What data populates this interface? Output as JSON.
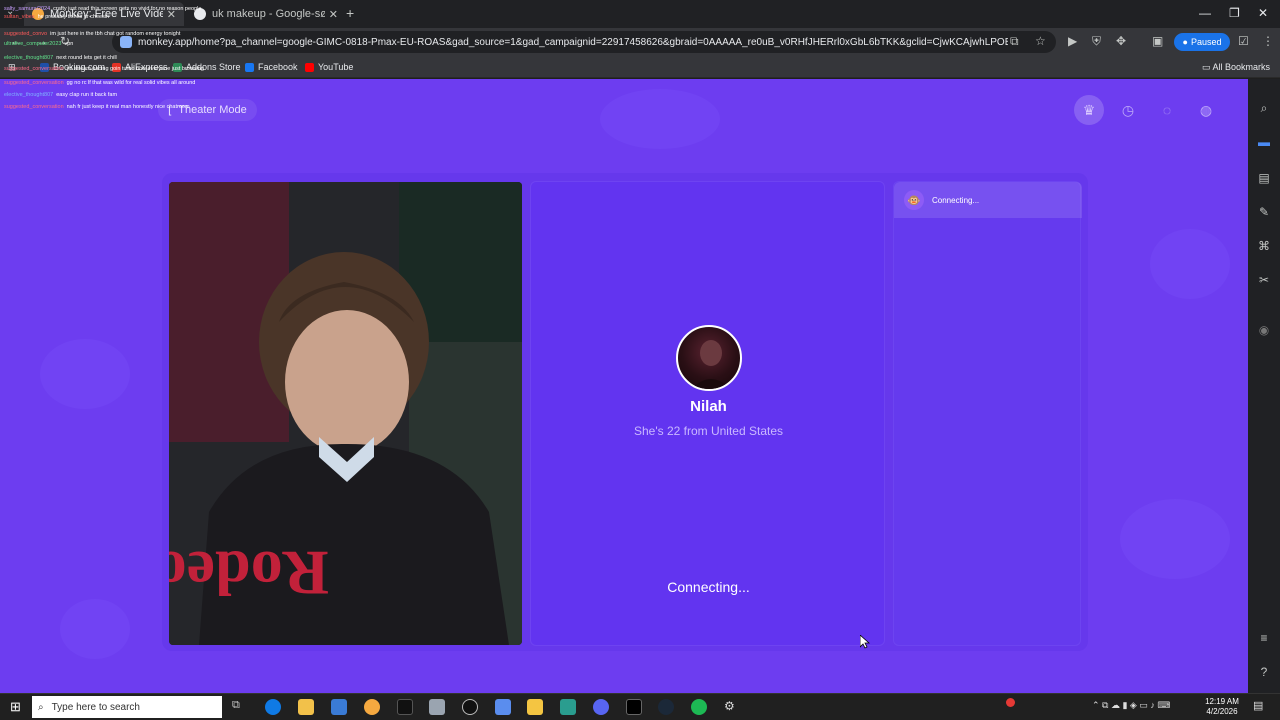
{
  "browser": {
    "tabs": [
      {
        "title": "Monkey: Free Live Video C"
      },
      {
        "title": "uk makeup - Google-søk"
      }
    ],
    "new_tab": "+",
    "omnibox": {
      "url": "monkey.app/home?pa_channel=google-GIMC-0818-Pmax-EU-ROAS&gad_source=1&gad_campaignid=22917458626&gbraid=0AAAAA_re0uB_v0RHfJHERrl0xGbL6bTKK&gclid=CjwKCAjwhLPOBhBiEiwA8_wJH..."
    },
    "profile": {
      "label": "Paused"
    },
    "bookmarks": [
      {
        "label": "Booking.com",
        "color": "#1e4fa8"
      },
      {
        "label": "AliExpress",
        "color": "#e43225"
      },
      {
        "label": "Addons Store",
        "color": "#2e8b57"
      },
      {
        "label": "Facebook",
        "color": "#1877f2"
      },
      {
        "label": "YouTube",
        "color": "#ff0000"
      }
    ],
    "all_bookmarks": "All Bookmarks"
  },
  "chat_overlay": [
    {
      "user": "salty_samurai2024",
      "msg": "crafty just read this screen gets no vivid for no reason people",
      "color": "#c9a0ff"
    },
    {
      "user": "sultan_vibes",
      "msg": "he probably thinks ur cheesin",
      "color": "#ff5a5a"
    },
    {
      "user": "suggested_convo",
      "msg": "im just here in the tbh chat got random energy tonight",
      "color": "#ff5a5a"
    },
    {
      "user": "ultrafive_computer2023",
      "msg": "vpn",
      "color": "#62e28c"
    },
    {
      "user": "elective_thought807",
      "msg": "next round lets get it chill",
      "color": "#62e28c"
    },
    {
      "user": "suggested_conversation",
      "msg": "yo stream pacing goin turbo now everyone just browsing",
      "color": "#ff6b8a"
    },
    {
      "user": "suggested_conversation",
      "msg": "gg no rc lf that was wild for real solid vibes all around",
      "color": "#ff6b8a"
    },
    {
      "user": "elective_thought807",
      "msg": "easy clap run it back fam",
      "color": "#7fb2ff"
    },
    {
      "user": "suggested_conversation",
      "msg": "nah fr just keep it real man honestly nice chatroom",
      "color": "#ff6b8a"
    }
  ],
  "app": {
    "theater_mode": "Theater Mode",
    "peer": {
      "name": "Nilah",
      "info": "She's 22 from United States",
      "status": "Connecting..."
    },
    "chat_panel": {
      "status": "Connecting..."
    },
    "top_icons": [
      "crown-icon",
      "history-icon",
      "chat-bubble-icon",
      "mask-icon"
    ]
  },
  "taskbar": {
    "search_placeholder": "Type here to search",
    "time": "12:19 AM",
    "date": "4/2/2026"
  }
}
